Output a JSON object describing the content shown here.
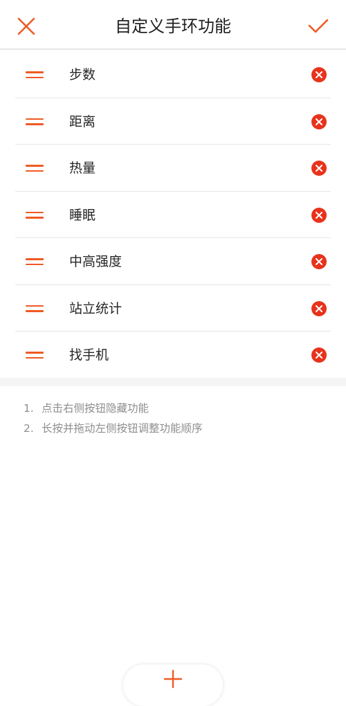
{
  "header": {
    "title": "自定义手环功能",
    "close_icon": "close-icon",
    "confirm_icon": "check-icon"
  },
  "colors": {
    "accent": "#ee5a24",
    "remove": "#e8331c",
    "divider": "#e6e6e6",
    "band": "#f5f5f5",
    "tip_text": "#8e8e8e"
  },
  "features": {
    "items": [
      {
        "label": "步数"
      },
      {
        "label": "距离"
      },
      {
        "label": "热量"
      },
      {
        "label": "睡眠"
      },
      {
        "label": "中高强度"
      },
      {
        "label": "站立统计"
      },
      {
        "label": "找手机"
      }
    ]
  },
  "tips": {
    "items": [
      {
        "num": "1.",
        "text": "点击右侧按钮隐藏功能"
      },
      {
        "num": "2.",
        "text": "长按并拖动左侧按钮调整功能顺序"
      }
    ]
  },
  "add_button": {
    "icon": "plus-icon"
  }
}
